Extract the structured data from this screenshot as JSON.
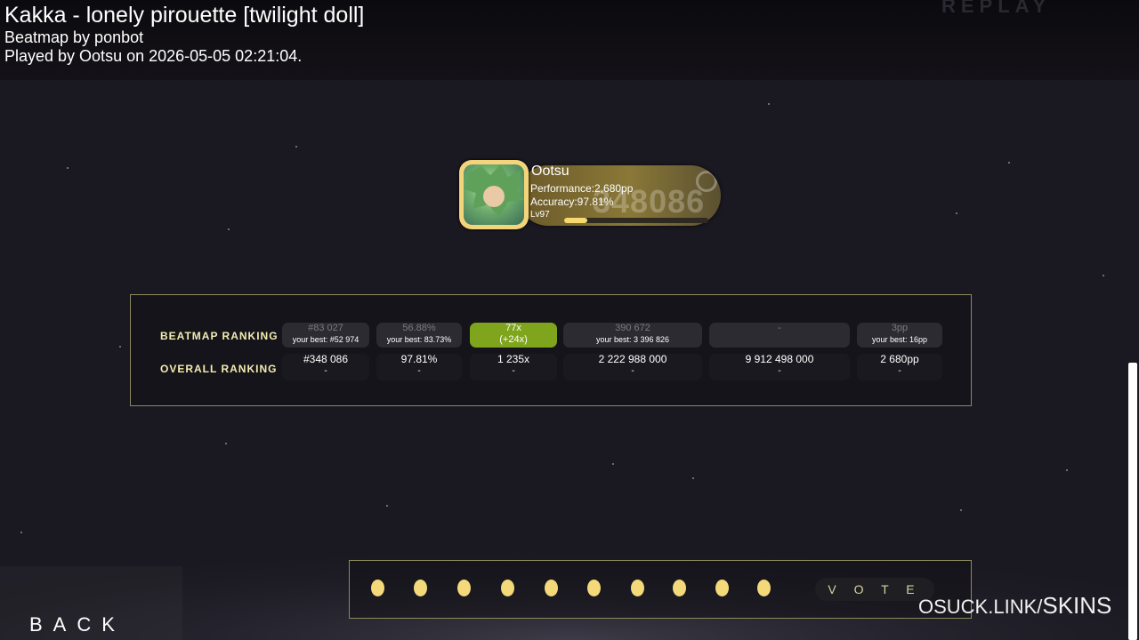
{
  "header": {
    "title": "Kakka - lonely pirouette [twilight doll]",
    "beatmap_by": "Beatmap by ponbot",
    "played_by": "Played by Ootsu on 2026-05-05 02:21:04.",
    "replay_tag": "REPLAY"
  },
  "player": {
    "name": "Ootsu",
    "performance": "Performance:2,680pp",
    "accuracy": "Accuracy:97.81%",
    "level": "Lv97",
    "level_progress": 0.16,
    "ghost_number": "348086"
  },
  "rankings": {
    "row_labels": [
      "BEATMAP RANKING",
      "OVERALL RANKING"
    ],
    "beatmap_row": [
      {
        "main": "#83 027",
        "best": "your best: #52 974"
      },
      {
        "main": "56.88%",
        "best": "your best: 83.73%"
      },
      {
        "main": "77x",
        "best": "(+24x)"
      },
      {
        "main": "390 672",
        "best": "your best: 3 396 826"
      },
      {
        "main": "-",
        "best": ""
      },
      {
        "main": "3pp",
        "best": "your best: 16pp"
      }
    ],
    "overall_row": [
      {
        "main": "#348 086",
        "sub": "-"
      },
      {
        "main": "97.81%",
        "sub": "-"
      },
      {
        "main": "1 235x",
        "sub": "-"
      },
      {
        "main": "2 222 988 000",
        "sub": "-"
      },
      {
        "main": "9 912 498 000",
        "sub": "-"
      },
      {
        "main": "2 680pp",
        "sub": "-"
      }
    ]
  },
  "vote": {
    "star_count": 10,
    "button_label": "V O T E"
  },
  "back_label": "BACK",
  "watermark": {
    "prefix": "OSUCK.LINK/",
    "suffix": "SKINS"
  },
  "colors": {
    "accent_gold": "#f4d97a",
    "highlight_green": "#7ea51c",
    "label_yellow": "#f2ecb0"
  }
}
